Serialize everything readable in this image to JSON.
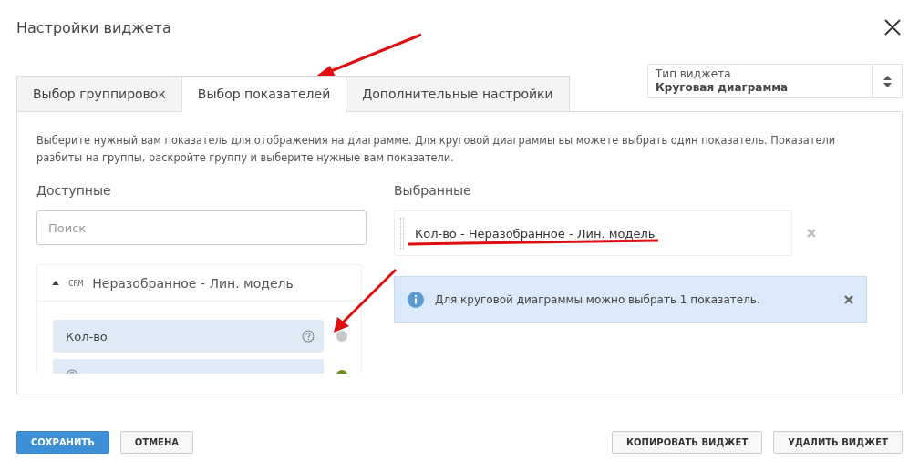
{
  "window": {
    "title": "Настройки виджета"
  },
  "tabs": [
    {
      "label": "Выбор группировок",
      "selected": false
    },
    {
      "label": "Выбор показателей",
      "selected": true
    },
    {
      "label": "Дополнительные настройки",
      "selected": false
    }
  ],
  "widget_type": {
    "label": "Тип виджета",
    "value": "Круговая диаграмма"
  },
  "description": "Выберите нужный вам показатель для отображения на диаграмме. Для круговой диаграммы вы можете выбрать один показатель. Показатели разбиты на группы, раскройте группу и выберите нужные вам показатели.",
  "available": {
    "label": "Доступные",
    "search": {
      "placeholder": "Поиск"
    },
    "group": {
      "badge": "CRM",
      "name": "Неразобранное - Лин. модель",
      "expanded": true,
      "items": [
        {
          "label": "Кол-во",
          "color": "#c8c8c8"
        },
        {
          "kind": "cut",
          "color": "#6b8e23"
        }
      ]
    }
  },
  "selected": {
    "label": "Выбранные",
    "items": [
      {
        "label": "Кол-во - Неразобранное - Лин. модель"
      }
    ]
  },
  "alert": {
    "text": "Для круговой диаграммы можно выбрать 1 показатель."
  },
  "footer": {
    "left": [
      {
        "label": "СОХРАНИТЬ",
        "kind": "primary"
      },
      {
        "label": "ОТМЕНА",
        "kind": "default"
      }
    ],
    "right": [
      {
        "label": "КОПИРОВАТЬ ВИДЖЕТ",
        "kind": "default"
      },
      {
        "label": "УДАЛИТЬ ВИДЖЕТ",
        "kind": "default"
      }
    ]
  }
}
